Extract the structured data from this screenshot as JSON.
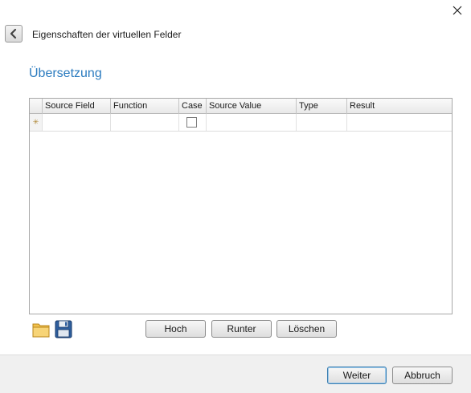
{
  "window": {
    "close_icon": "close-icon"
  },
  "header": {
    "back_icon": "chevron-left-icon",
    "title": "Eigenschaften der virtuellen Felder"
  },
  "section": {
    "title": "Übersetzung"
  },
  "grid": {
    "columns": [
      "Source Field",
      "Function",
      "Case",
      "Source Value",
      "Type",
      "Result"
    ],
    "new_row_icon": "new-row-asterisk-icon",
    "new_row": {
      "case_checked": false
    }
  },
  "toolbar": {
    "open_icon": "folder-icon",
    "save_icon": "floppy-disk-icon",
    "up_label": "Hoch",
    "down_label": "Runter",
    "delete_label": "Löschen"
  },
  "footer": {
    "next_label": "Weiter",
    "cancel_label": "Abbruch"
  }
}
